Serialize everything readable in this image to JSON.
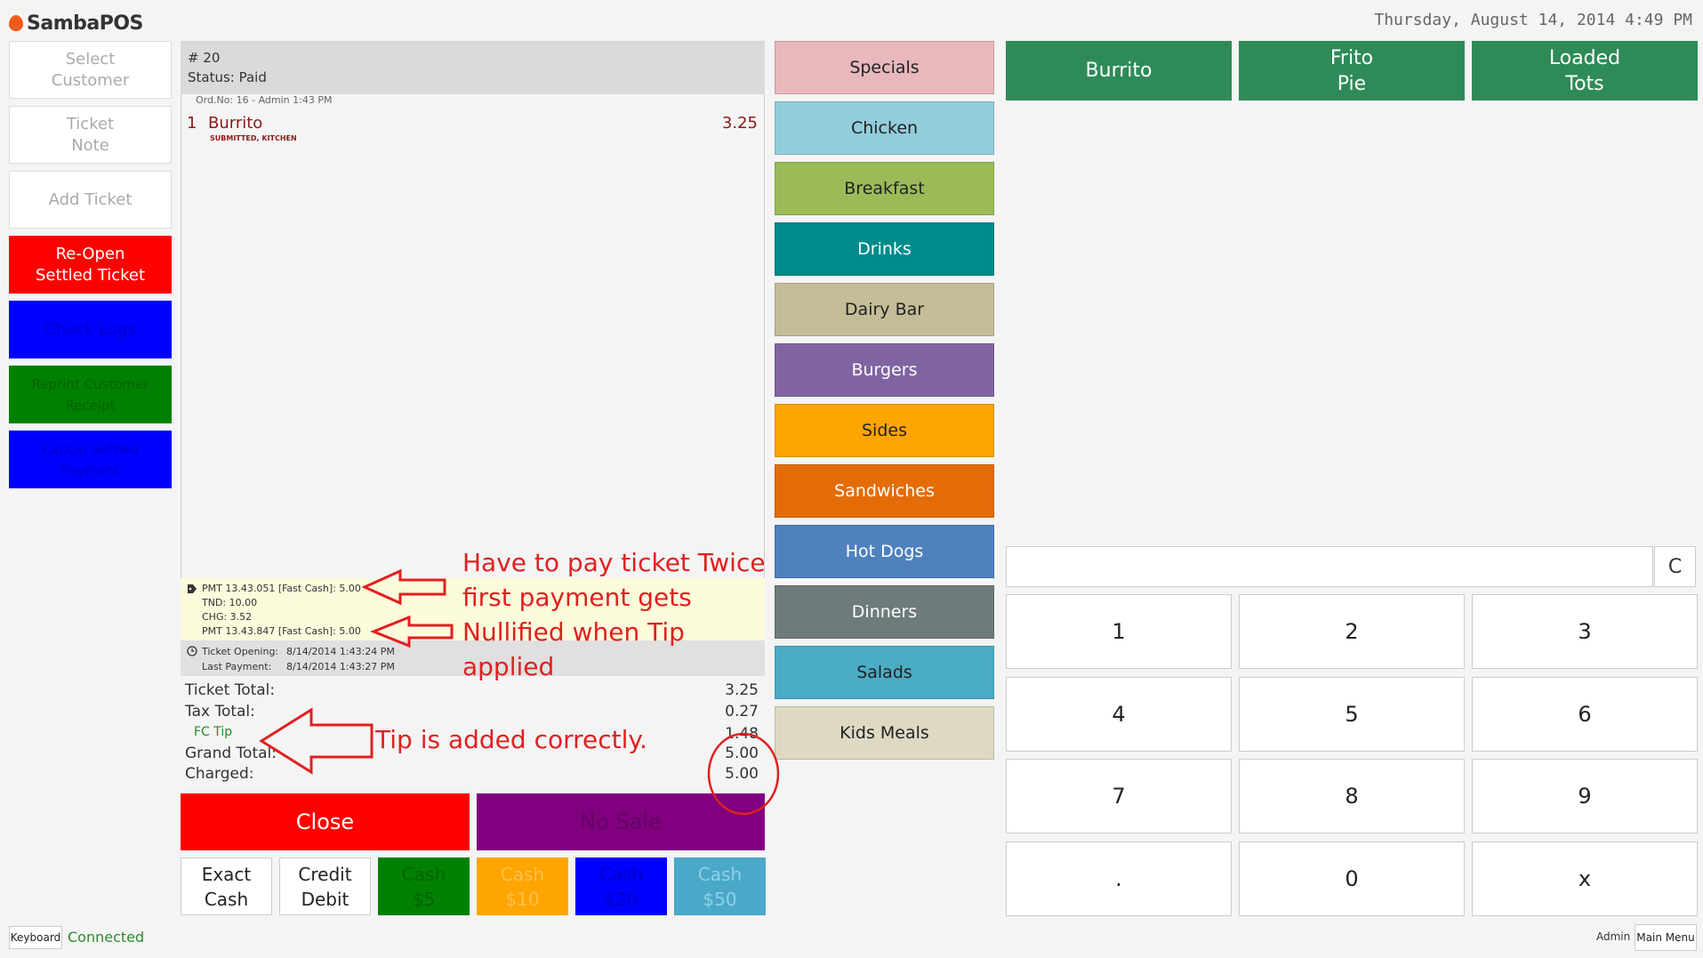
{
  "header": {
    "app_name": "SambaPOS",
    "datetime": "Thursday, August 14, 2014 4:49 PM"
  },
  "sidebar": {
    "buttons": [
      {
        "label": "Select\nCustomer",
        "bg": "#ffffff",
        "fg": "#aaaaaa"
      },
      {
        "label": "Ticket\nNote",
        "bg": "#ffffff",
        "fg": "#aaaaaa"
      },
      {
        "label": "Add Ticket",
        "bg": "#ffffff",
        "fg": "#aaaaaa"
      },
      {
        "label": "Re-Open\nSettled Ticket",
        "bg": "#ff0000",
        "fg": "#ffffff"
      },
      {
        "label": "Check Logs",
        "bg": "#0000ff",
        "fg": "#0000c8"
      },
      {
        "label": "Reprint Customer Receipt",
        "bg": "#008000",
        "fg": "#006400"
      },
      {
        "label": "Cancel Settled Payment",
        "bg": "#0000ff",
        "fg": "#0000c8"
      }
    ]
  },
  "ticket": {
    "number": "# 20",
    "status": "Status: Paid",
    "order_info": "Ord.No: 16 - Admin  1:43 PM",
    "orders": [
      {
        "qty": "1",
        "name": "Burrito",
        "price": "3.25",
        "tags": "SUBMITTED, KITCHEN"
      }
    ],
    "payments": [
      "PMT 13.43.051 [Fast Cash]: 5.00",
      "TND: 10.00",
      "CHG: 3.52",
      "PMT 13.43.847 [Fast Cash]: 5.00"
    ],
    "times": {
      "opening_label": "Ticket Opening:",
      "opening_value": "8/14/2014 1:43:24 PM",
      "last_payment_label": "Last Payment:",
      "last_payment_value": "8/14/2014 1:43:27 PM"
    },
    "totals": {
      "ticket_total_label": "Ticket Total:",
      "ticket_total_value": "3.25",
      "tax_total_label": "Tax Total:",
      "tax_total_value": "0.27",
      "tip_label": "FC Tip",
      "tip_value": "1.48",
      "grand_total_label": "Grand Total:",
      "grand_total_value": "5.00",
      "charged_label": "Charged:",
      "charged_value": "5.00"
    }
  },
  "actions": {
    "close_label": "Close",
    "no_sale_label": "No Sale",
    "payment_buttons": [
      {
        "label": "Exact\nCash",
        "bg": "#ffffff",
        "fg": "#222222"
      },
      {
        "label": "Credit\nDebit",
        "bg": "#ffffff",
        "fg": "#222222"
      },
      {
        "label": "Cash\n$5",
        "bg": "#008000",
        "fg": "#006400"
      },
      {
        "label": "Cash\n$10",
        "bg": "#ffa500",
        "fg": "#ffc04d"
      },
      {
        "label": "Cash\n$20",
        "bg": "#0000ff",
        "fg": "#0000c8"
      },
      {
        "label": "Cash\n$50",
        "bg": "#4aa8c8",
        "fg": "#8fd0e8"
      }
    ]
  },
  "categories": [
    {
      "label": "Specials",
      "bg": "#e8b8bc",
      "fg": "#222222"
    },
    {
      "label": "Chicken",
      "bg": "#92cddc",
      "fg": "#222222"
    },
    {
      "label": "Breakfast",
      "bg": "#9bbb59",
      "fg": "#222222"
    },
    {
      "label": "Drinks",
      "bg": "#008b8b",
      "fg": "#ffffff"
    },
    {
      "label": "Dairy Bar",
      "bg": "#c4bd97",
      "fg": "#222222"
    },
    {
      "label": "Burgers",
      "bg": "#8064a2",
      "fg": "#ffffff"
    },
    {
      "label": "Sides",
      "bg": "#ffa500",
      "fg": "#222222"
    },
    {
      "label": "Sandwiches",
      "bg": "#e36c09",
      "fg": "#ffffff"
    },
    {
      "label": "Hot Dogs",
      "bg": "#4f81bd",
      "fg": "#ffffff"
    },
    {
      "label": "Dinners",
      "bg": "#6e7b7b",
      "fg": "#ffffff"
    },
    {
      "label": "Salads",
      "bg": "#4bacc6",
      "fg": "#222222"
    },
    {
      "label": "Kids Meals",
      "bg": "#ddd9c3",
      "fg": "#222222"
    }
  ],
  "products": [
    {
      "label": "Burrito"
    },
    {
      "label": "Frito\nPie"
    },
    {
      "label": "Loaded\nTots"
    }
  ],
  "numpad": {
    "input_value": "",
    "clear_label": "C",
    "keys": [
      "1",
      "2",
      "3",
      "4",
      "5",
      "6",
      "7",
      "8",
      "9",
      ".",
      "0",
      "x"
    ]
  },
  "statusbar": {
    "keyboard_label": "Keyboard",
    "connection_status": "Connected",
    "user_label": "Admin",
    "main_menu_label": "Main Menu"
  },
  "annotations": {
    "note_1": [
      "Have to pay ticket Twice",
      "first payment gets",
      "Nullified when Tip",
      "applied"
    ],
    "note_2": "Tip is added correctly."
  }
}
